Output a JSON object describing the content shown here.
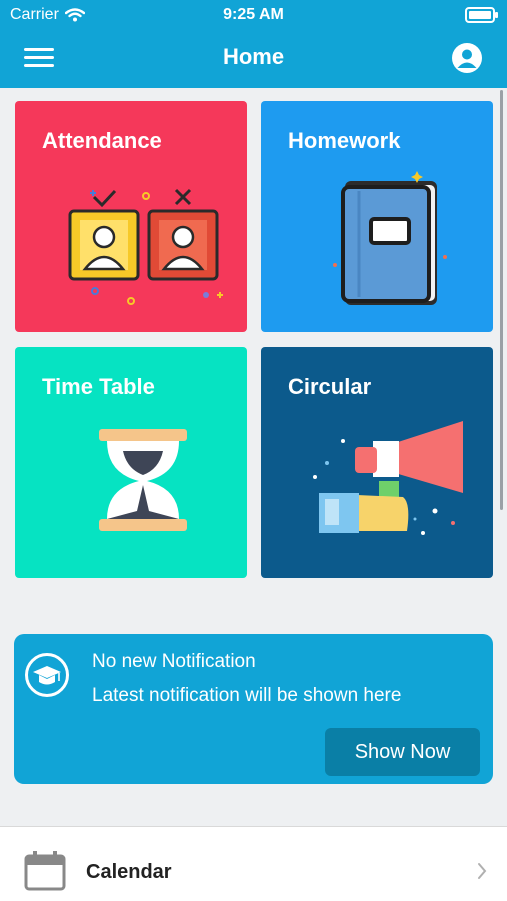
{
  "status_bar": {
    "carrier": "Carrier",
    "time": "9:25 AM"
  },
  "header": {
    "title": "Home"
  },
  "tiles": [
    {
      "title": "Attendance",
      "color": "#f5385a",
      "icon": "attendance-icon"
    },
    {
      "title": "Homework",
      "color": "#1e9bf0",
      "icon": "book-icon"
    },
    {
      "title": "Time Table",
      "color": "#06e3c2",
      "icon": "hourglass-icon"
    },
    {
      "title": "Circular",
      "color": "#0c5a8c",
      "icon": "megaphone-icon"
    }
  ],
  "notification": {
    "title": "No new Notification",
    "message": "Latest notification will be shown here",
    "button_label": "Show Now",
    "icon": "graduation-cap-icon"
  },
  "calendar": {
    "label": "Calendar",
    "icon": "calendar-icon"
  },
  "colors": {
    "accent": "#11a4d6",
    "background": "#eef0f2",
    "button": "#0a7fa6"
  }
}
